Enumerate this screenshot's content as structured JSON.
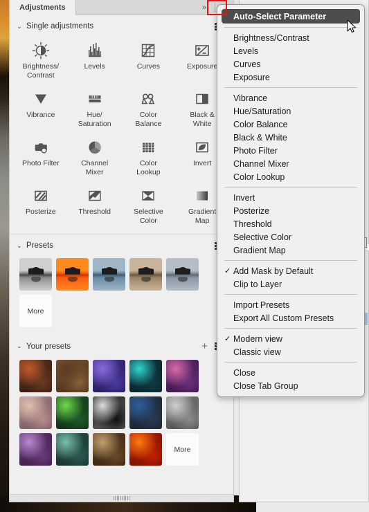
{
  "panel": {
    "tab_label": "Adjustments",
    "chevrons": "»",
    "menu_icon": "hamburger-menu-icon"
  },
  "sections": {
    "single_adjustments": {
      "title": "Single adjustments",
      "twisty": "⌄",
      "items": [
        {
          "label": "Brightness/\nContrast",
          "icon": "brightness-contrast-icon"
        },
        {
          "label": "Levels",
          "icon": "levels-icon"
        },
        {
          "label": "Curves",
          "icon": "curves-icon"
        },
        {
          "label": "Exposure",
          "icon": "exposure-icon"
        },
        {
          "label": "Vibrance",
          "icon": "vibrance-icon"
        },
        {
          "label": "Hue/\nSaturation",
          "icon": "hue-saturation-icon"
        },
        {
          "label": "Color\nBalance",
          "icon": "color-balance-icon"
        },
        {
          "label": "Black &\nWhite",
          "icon": "black-white-icon"
        },
        {
          "label": "Photo Filter",
          "icon": "photo-filter-icon"
        },
        {
          "label": "Channel\nMixer",
          "icon": "channel-mixer-icon"
        },
        {
          "label": "Color\nLookup",
          "icon": "color-lookup-icon"
        },
        {
          "label": "Invert",
          "icon": "invert-icon"
        },
        {
          "label": "Posterize",
          "icon": "posterize-icon"
        },
        {
          "label": "Threshold",
          "icon": "threshold-icon"
        },
        {
          "label": "Selective\nColor",
          "icon": "selective-color-icon"
        },
        {
          "label": "Gradient\nMap",
          "icon": "gradient-map-icon"
        }
      ]
    },
    "presets": {
      "title": "Presets",
      "twisty": "⌄",
      "more_label": "More",
      "thumbnails": [
        {
          "name": "preset-bw-landscape",
          "colors": [
            "#cfcfcf",
            "#8e8e8e",
            "#4a4a4a"
          ]
        },
        {
          "name": "preset-orange-sunset",
          "colors": [
            "#ff8a1e",
            "#ff5a10",
            "#c63a06"
          ]
        },
        {
          "name": "preset-cool-blue",
          "colors": [
            "#9fb6c9",
            "#6d8ba3",
            "#3f5d75"
          ]
        },
        {
          "name": "preset-sepia",
          "colors": [
            "#c9b49a",
            "#9d8468",
            "#6b563e"
          ]
        },
        {
          "name": "preset-desaturated-blue",
          "colors": [
            "#b4bec8",
            "#8b97a4",
            "#5b6873"
          ]
        }
      ]
    },
    "your_presets": {
      "title": "Your presets",
      "twisty": "⌄",
      "add_label": "+",
      "more_label": "More",
      "thumbnails": [
        {
          "name": "user-preset-fantasy-warrior",
          "colors": [
            "#6b3a22",
            "#c0592b",
            "#1d1008"
          ]
        },
        {
          "name": "user-preset-desert",
          "colors": [
            "#8a6038",
            "#5c3d22",
            "#2d1d10"
          ]
        },
        {
          "name": "user-preset-neon-rain",
          "colors": [
            "#4a3a9e",
            "#8a6ae0",
            "#1a1040"
          ]
        },
        {
          "name": "user-preset-teal-tank",
          "colors": [
            "#0f3c44",
            "#2fd6d0",
            "#051a1f"
          ]
        },
        {
          "name": "user-preset-purple-moon",
          "colors": [
            "#6a2f7a",
            "#d96aa8",
            "#2a1038"
          ]
        },
        {
          "name": "user-preset-octopus",
          "colors": [
            "#b88c8c",
            "#e0c0b0",
            "#5a4a55"
          ]
        },
        {
          "name": "user-preset-green-dragon",
          "colors": [
            "#1f5a28",
            "#6fd84a",
            "#0a2010"
          ]
        },
        {
          "name": "user-preset-grayscale-test",
          "colors": [
            "#111111",
            "#dddddd",
            "#777777"
          ]
        },
        {
          "name": "user-preset-blue-truck",
          "colors": [
            "#2a3a50",
            "#2d5f9e",
            "#141c28"
          ]
        },
        {
          "name": "user-preset-cars",
          "colors": [
            "#8a8a8a",
            "#cfcfcf",
            "#3a3a3a"
          ]
        },
        {
          "name": "user-preset-purple-leaves",
          "colors": [
            "#6a3a7a",
            "#b88ad0",
            "#2a1430"
          ]
        },
        {
          "name": "user-preset-teal-leaves",
          "colors": [
            "#2a5a52",
            "#7ac0aa",
            "#10201c"
          ]
        },
        {
          "name": "user-preset-brown-leaves",
          "colors": [
            "#6a4a2a",
            "#c0a070",
            "#241608"
          ]
        },
        {
          "name": "user-preset-red-leaves",
          "colors": [
            "#c02000",
            "#ff7a10",
            "#5a0c00"
          ]
        }
      ]
    }
  },
  "menu": {
    "items": [
      {
        "label": "Auto-Select Parameter",
        "selected": true,
        "checked": false,
        "name": "menu-item-auto-select-parameter"
      },
      {
        "separator": true
      },
      {
        "label": "Brightness/Contrast",
        "checked": false,
        "name": "menu-item-brightness-contrast"
      },
      {
        "label": "Levels",
        "checked": false,
        "name": "menu-item-levels"
      },
      {
        "label": "Curves",
        "checked": false,
        "name": "menu-item-curves"
      },
      {
        "label": "Exposure",
        "checked": false,
        "name": "menu-item-exposure"
      },
      {
        "separator": true
      },
      {
        "label": "Vibrance",
        "checked": false,
        "name": "menu-item-vibrance"
      },
      {
        "label": "Hue/Saturation",
        "checked": false,
        "name": "menu-item-hue-saturation"
      },
      {
        "label": "Color Balance",
        "checked": false,
        "name": "menu-item-color-balance"
      },
      {
        "label": "Black & White",
        "checked": false,
        "name": "menu-item-black-white"
      },
      {
        "label": "Photo Filter",
        "checked": false,
        "name": "menu-item-photo-filter"
      },
      {
        "label": "Channel Mixer",
        "checked": false,
        "name": "menu-item-channel-mixer"
      },
      {
        "label": "Color Lookup",
        "checked": false,
        "name": "menu-item-color-lookup"
      },
      {
        "separator": true
      },
      {
        "label": "Invert",
        "checked": false,
        "name": "menu-item-invert"
      },
      {
        "label": "Posterize",
        "checked": false,
        "name": "menu-item-posterize"
      },
      {
        "label": "Threshold",
        "checked": false,
        "name": "menu-item-threshold"
      },
      {
        "label": "Selective Color",
        "checked": false,
        "name": "menu-item-selective-color"
      },
      {
        "label": "Gradient Map",
        "checked": false,
        "name": "menu-item-gradient-map"
      },
      {
        "separator": true
      },
      {
        "label": "Add Mask by Default",
        "checked": true,
        "name": "menu-item-add-mask-by-default"
      },
      {
        "label": "Clip to Layer",
        "checked": false,
        "name": "menu-item-clip-to-layer"
      },
      {
        "separator": true
      },
      {
        "label": "Import Presets",
        "checked": false,
        "name": "menu-item-import-presets"
      },
      {
        "label": "Export All Custom Presets",
        "checked": false,
        "name": "menu-item-export-all-custom-presets"
      },
      {
        "separator": true
      },
      {
        "label": "Modern view",
        "checked": true,
        "name": "menu-item-modern-view"
      },
      {
        "label": "Classic view",
        "checked": false,
        "name": "menu-item-classic-view"
      },
      {
        "separator": true
      },
      {
        "label": "Close",
        "checked": false,
        "name": "menu-item-close"
      },
      {
        "label": "Close Tab Group",
        "checked": false,
        "name": "menu-item-close-tab-group"
      }
    ],
    "check_glyph": "✓"
  },
  "colors": {
    "panel_bg": "#efefef",
    "menu_bg": "#f0f0f0",
    "menu_selected_bg": "#4d4d4d",
    "highlight_box": "#ee1111",
    "text": "#1a1a1a"
  }
}
